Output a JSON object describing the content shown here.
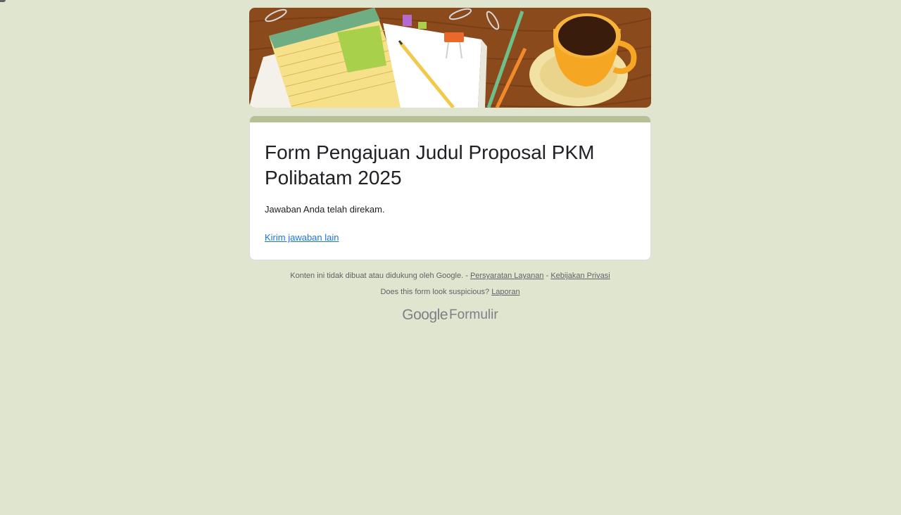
{
  "form": {
    "title": "Form Pengajuan Judul Proposal PKM Polibatam 2025",
    "confirmation": "Jawaban Anda telah direkam.",
    "resubmit_link": "Kirim jawaban lain"
  },
  "footer": {
    "disclaimer": "Konten ini tidak dibuat atau didukung oleh Google. -",
    "terms_link": "Persyaratan Layanan",
    "separator": "-",
    "privacy_link": "Kebijakan Privasi",
    "suspicious_text": "Does this form look suspicious?",
    "report_link": "Laporan"
  },
  "brand": {
    "google": "Google",
    "product": "Formulir"
  },
  "colors": {
    "background": "#e0e5cf",
    "accent": "#b5c192",
    "link": "#1a73e8"
  },
  "icons": {
    "header": "desk-illustration"
  }
}
